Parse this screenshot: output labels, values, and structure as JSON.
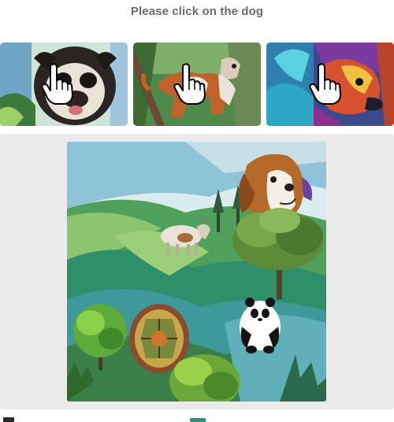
{
  "prompt": {
    "text": "Please click on the dog"
  },
  "choices": [
    {
      "subject": "pug",
      "icon": "hand-pointer-icon"
    },
    {
      "subject": "brown-white dog",
      "icon": "hand-pointer-icon"
    },
    {
      "subject": "colorful dog",
      "icon": "hand-pointer-icon"
    }
  ],
  "scene": {
    "animals": [
      "beagle",
      "goat",
      "panda",
      "turtle"
    ]
  },
  "colors": {
    "panel_bg": "#ebebeb",
    "prompt_text": "#6b6b6b",
    "cursor_fill": "#ffffff",
    "cursor_stroke": "#000000"
  }
}
